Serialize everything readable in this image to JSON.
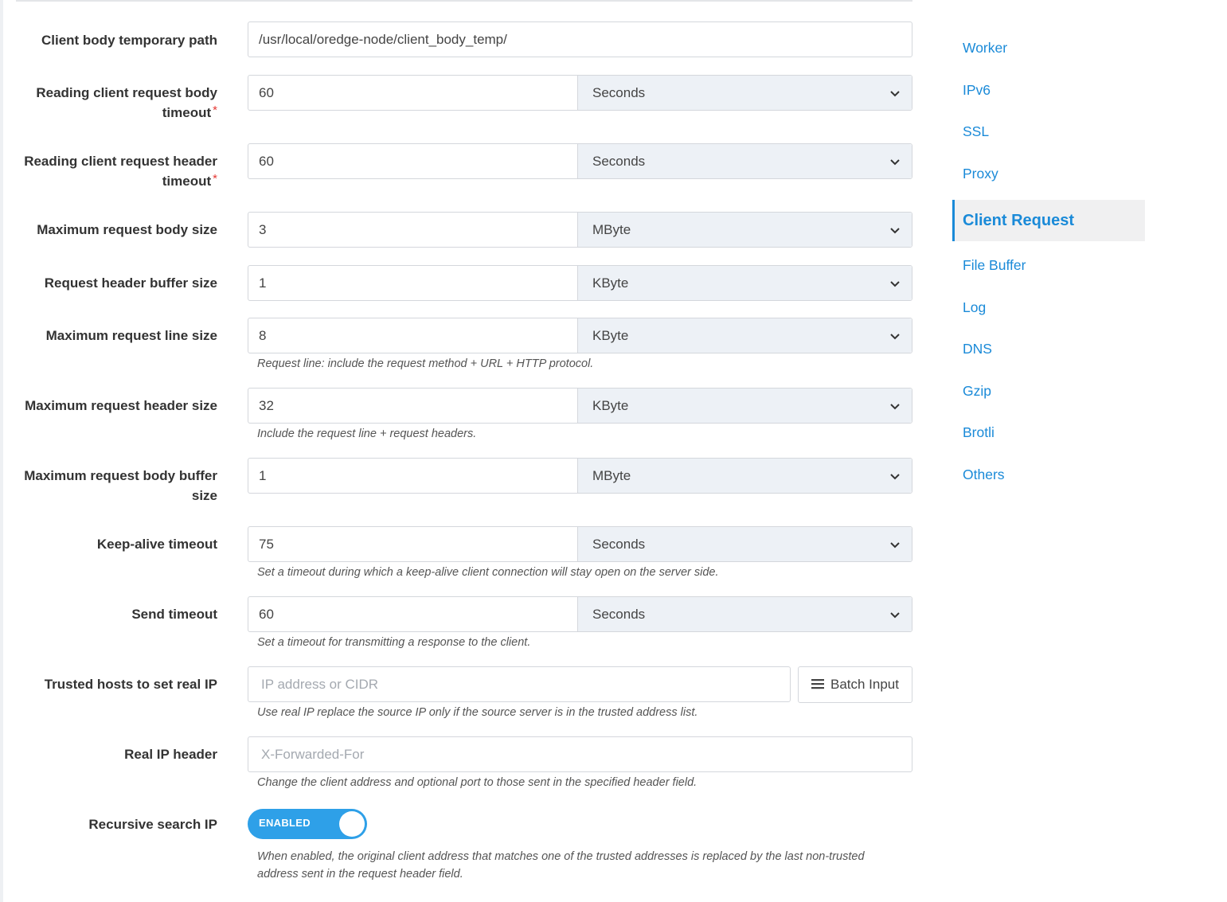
{
  "form": {
    "rows": [
      {
        "label": "Client body temporary path",
        "required": false,
        "value": "/usr/local/oredge-node/client_body_temp/"
      },
      {
        "label_lines": [
          "Reading client request body",
          "timeout"
        ],
        "required": true,
        "value": "60",
        "unit": "Seconds"
      },
      {
        "label_lines": [
          "Reading client request header",
          "timeout"
        ],
        "required": true,
        "value": "60",
        "unit": "Seconds"
      },
      {
        "label": "Maximum request body size",
        "required": false,
        "value": "3",
        "unit": "MByte"
      },
      {
        "label": "Request header buffer size",
        "required": false,
        "value": "1",
        "unit": "KByte"
      },
      {
        "label": "Maximum request line size",
        "required": false,
        "value": "8",
        "unit": "KByte",
        "help": "Request line: include the request method + URL + HTTP protocol."
      },
      {
        "label": "Maximum request header size",
        "required": false,
        "value": "32",
        "unit": "KByte",
        "help": "Include the request line + request headers."
      },
      {
        "label_lines": [
          "Maximum request body buffer",
          "size"
        ],
        "required": false,
        "value": "1",
        "unit": "MByte"
      },
      {
        "label": "Keep-alive timeout",
        "required": false,
        "value": "75",
        "unit": "Seconds",
        "help": "Set a timeout during which a keep-alive client connection will stay open on the server side."
      },
      {
        "label": "Send timeout",
        "required": false,
        "value": "60",
        "unit": "Seconds",
        "help": "Set a timeout for transmitting a response to the client."
      },
      {
        "label": "Trusted hosts to set real IP",
        "placeholder": "IP address or CIDR",
        "button": "Batch Input",
        "help": "Use real IP replace the source IP only if the source server is in the trusted address list."
      },
      {
        "label": "Real IP header",
        "placeholder": "X-Forwarded-For",
        "help": "Change the client address and optional port to those sent in the specified header field."
      },
      {
        "label": "Recursive search IP",
        "toggle": "ENABLED",
        "toggle_on": true,
        "help_lines": [
          "When enabled, the original client address that matches one of the trusted addresses is replaced by the last non-trusted",
          "address sent in the request header field."
        ]
      }
    ],
    "required_mark": "*"
  },
  "sidenav": {
    "items": [
      {
        "label": "Worker"
      },
      {
        "label": "IPv6"
      },
      {
        "label": "SSL"
      },
      {
        "label": "Proxy"
      },
      {
        "label": "Client Request",
        "active": true
      },
      {
        "label": "File Buffer"
      },
      {
        "label": "Log"
      },
      {
        "label": "DNS"
      },
      {
        "label": "Gzip"
      },
      {
        "label": "Brotli"
      },
      {
        "label": "Others"
      }
    ]
  },
  "colors": {
    "accent": "#1a8ad8",
    "toggle_on": "#2ea0e8",
    "required": "#e53935"
  },
  "icons": {
    "select": "chevron-down-icon",
    "batch": "list-icon"
  }
}
